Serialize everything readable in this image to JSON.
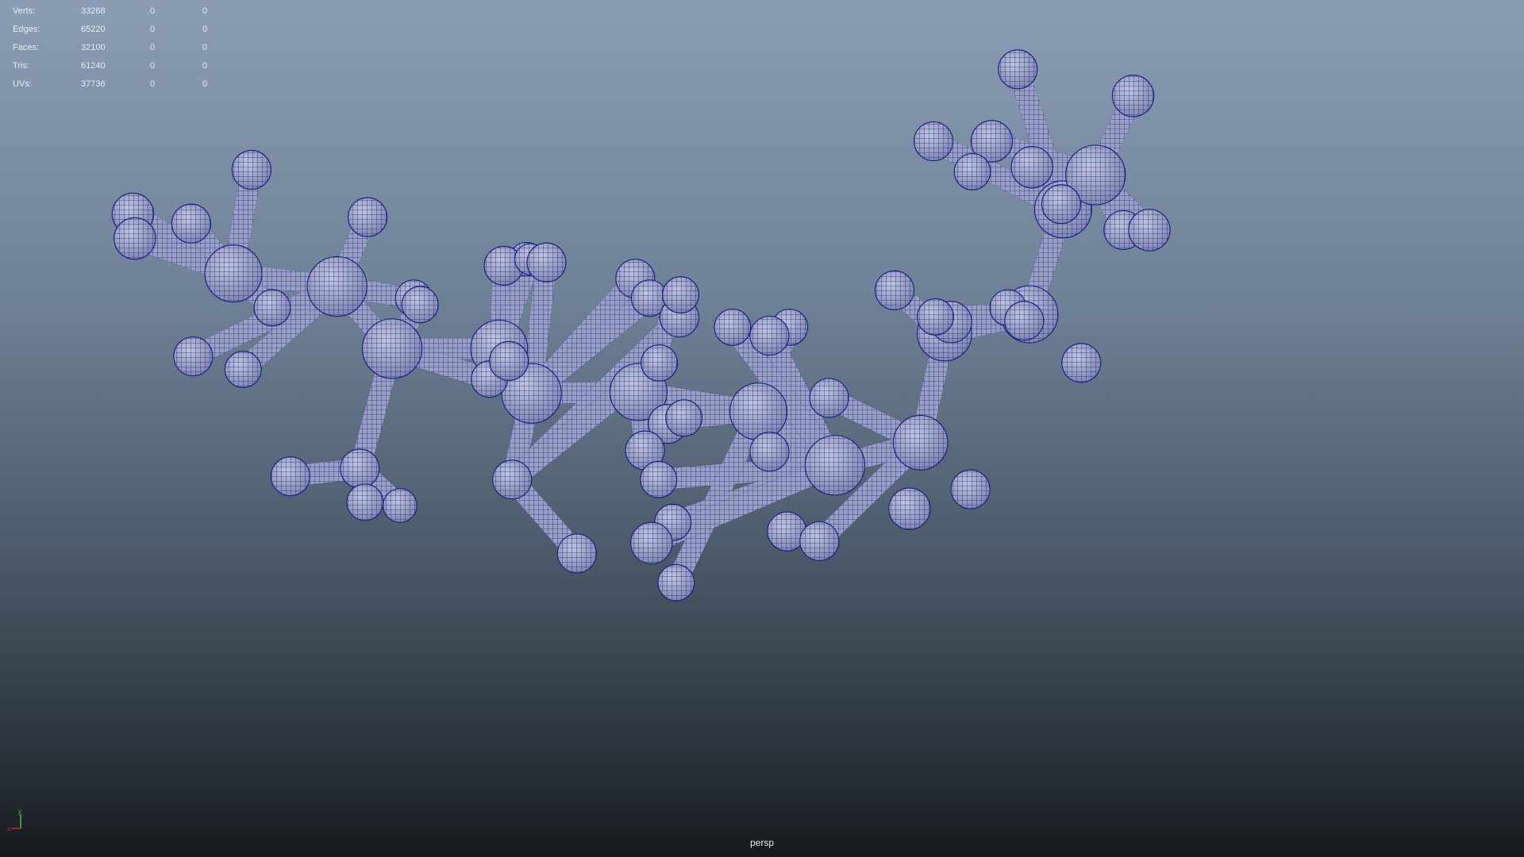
{
  "hud": {
    "rows": [
      {
        "label": "Verts:",
        "total": "33268",
        "c2": "0",
        "c3": "0"
      },
      {
        "label": "Edges:",
        "total": "65220",
        "c2": "0",
        "c3": "0"
      },
      {
        "label": "Faces:",
        "total": "32100",
        "c2": "0",
        "c3": "0"
      },
      {
        "label": "Tris:",
        "total": "61240",
        "c2": "0",
        "c3": "0"
      },
      {
        "label": "UVs:",
        "total": "37736",
        "c2": "0",
        "c3": "0"
      }
    ]
  },
  "viewport": {
    "camera_label": "persp",
    "axis_labels": {
      "x": "x",
      "y": "y"
    }
  },
  "colors": {
    "wireframe": "#1a237e",
    "mesh_fill": "#9aa0c4",
    "axis_x": "#d02828",
    "axis_y": "#3cc83c"
  }
}
